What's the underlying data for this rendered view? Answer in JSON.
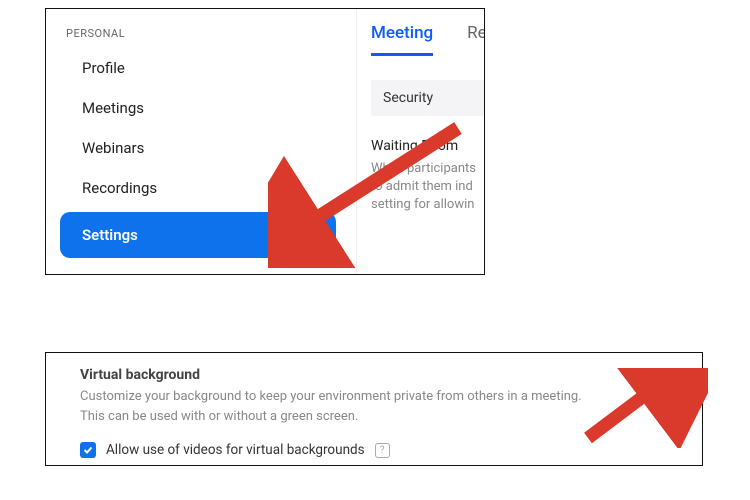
{
  "sidebar": {
    "section_label": "PERSONAL",
    "items": [
      {
        "label": "Profile"
      },
      {
        "label": "Meetings"
      },
      {
        "label": "Webinars"
      },
      {
        "label": "Recordings"
      },
      {
        "label": "Settings"
      }
    ]
  },
  "tabs": {
    "active": "Meeting",
    "second": "Re"
  },
  "subsection": {
    "label": "Security"
  },
  "waiting_room": {
    "title": "Waiting Room",
    "desc_line1": "When participants",
    "desc_line2": "to admit them ind",
    "desc_line3": "setting for allowin"
  },
  "virtual_bg": {
    "title": "Virtual background",
    "desc": "Customize your background to keep your environment private from others in a meeting. This can be used with or without a green screen.",
    "checkbox_label": "Allow use of videos for virtual backgrounds",
    "checkbox_checked": true,
    "toggle_on": true
  },
  "colors": {
    "accent": "#0e72ec",
    "link": "#0e5cff",
    "arrow": "#d93a2b"
  }
}
